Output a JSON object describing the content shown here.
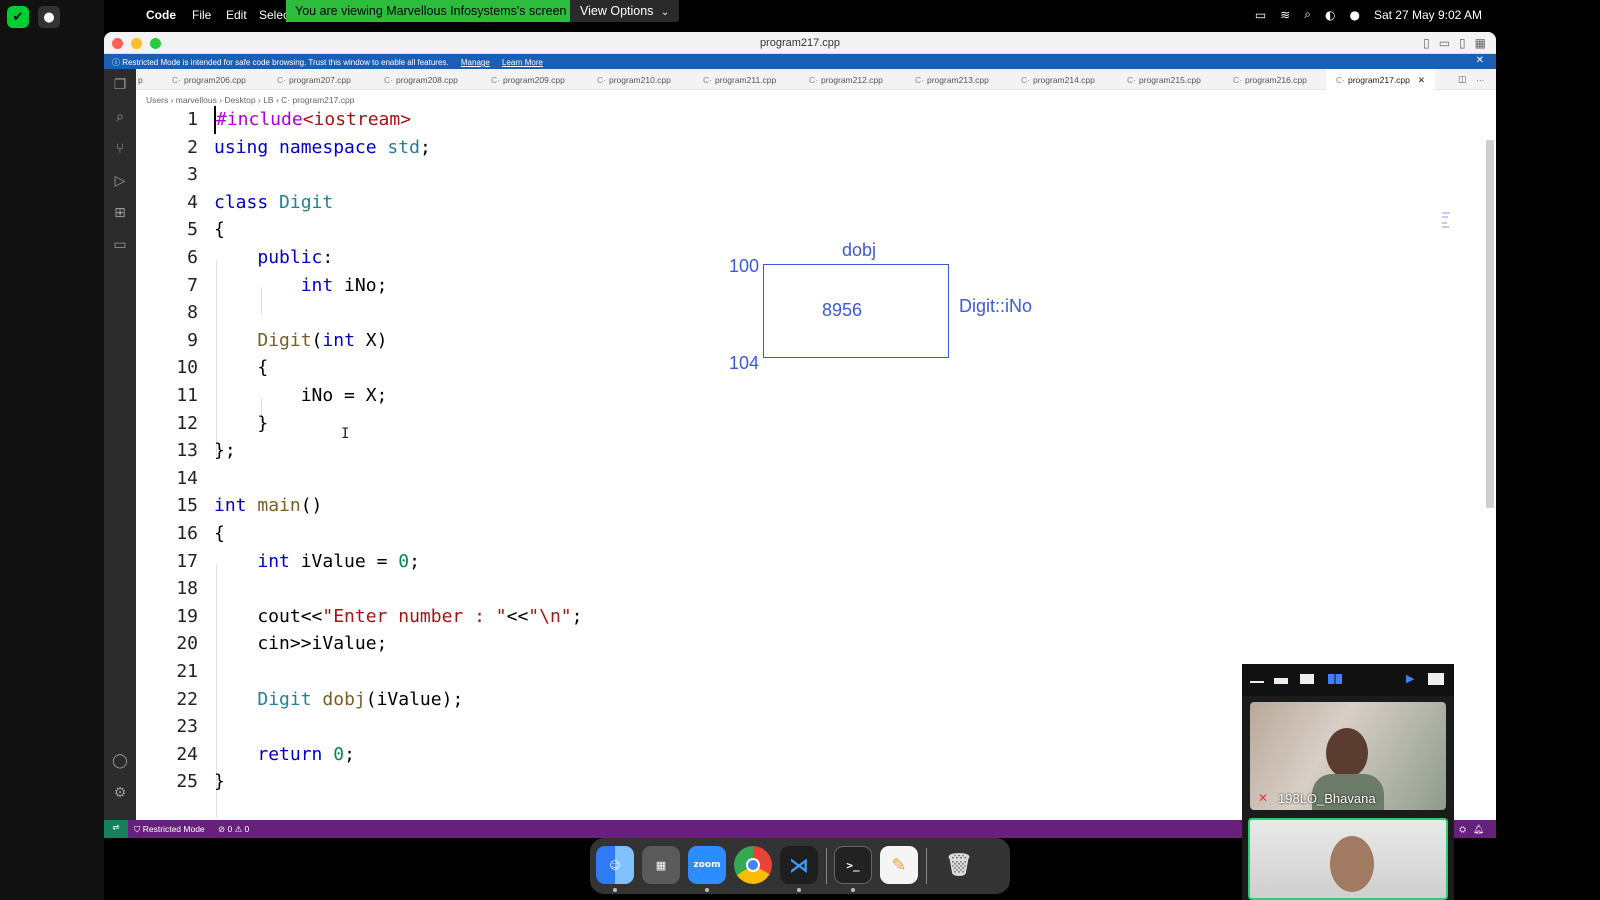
{
  "menubar": {
    "app": "Code",
    "items": [
      "File",
      "Edit",
      "Selec"
    ],
    "share_banner": "You are viewing Marvellous Infosystems's screen",
    "view_options": "View Options",
    "datetime": "Sat 27 May  9:02 AM"
  },
  "window": {
    "title": "program217.cpp",
    "restricted_text": "Restricted Mode is intended for safe code browsing. Trust this window to enable all features.",
    "manage": "Manage",
    "learn_more": "Learn More"
  },
  "tabs": {
    "overflow": "p",
    "items": [
      "program206.cpp",
      "program207.cpp",
      "program208.cpp",
      "program209.cpp",
      "program210.cpp",
      "program211.cpp",
      "program212.cpp",
      "program213.cpp",
      "program214.cpp",
      "program215.cpp",
      "program216.cpp"
    ],
    "active": "program217.cpp"
  },
  "breadcrumb": {
    "parts": [
      "Users",
      "marvellous",
      "Desktop",
      "LB",
      "program217.cpp"
    ]
  },
  "code": {
    "line_numbers": [
      "1",
      "2",
      "3",
      "4",
      "5",
      "6",
      "7",
      "8",
      "9",
      "10",
      "11",
      "12",
      "13",
      "14",
      "15",
      "16",
      "17",
      "18",
      "19",
      "20",
      "21",
      "22",
      "23",
      "24",
      "25"
    ],
    "lines": [
      "#include<iostream>",
      "using namespace std;",
      "",
      "class Digit",
      "{",
      "    public:",
      "        int iNo;",
      "",
      "    Digit(int X)",
      "    {",
      "        iNo = X;",
      "    }",
      "};",
      "",
      "int main()",
      "{",
      "    int iValue = 0;",
      "",
      "    cout<<\"Enter number : \"<<\"\\n\";",
      "    cin>>iValue;",
      "",
      "    Digit dobj(iValue);",
      "",
      "    return 0;",
      "}"
    ]
  },
  "drawing": {
    "object_name": "dobj",
    "start_address": "100",
    "end_address": "104",
    "value": "8956",
    "member_label": "Digit::iNo"
  },
  "statusbar": {
    "mode": "Restricted Mode",
    "problems": "⊘ 0 ⚠ 0"
  },
  "zoom": {
    "participant1": "198LO_Bhavana"
  },
  "dock": {
    "zoom_label": "zoom"
  },
  "colors": {
    "accent": "#1a5fb4",
    "status_bar": "#68217a",
    "share_banner": "#2dbd3c",
    "drawing": "#3a5bd9"
  }
}
